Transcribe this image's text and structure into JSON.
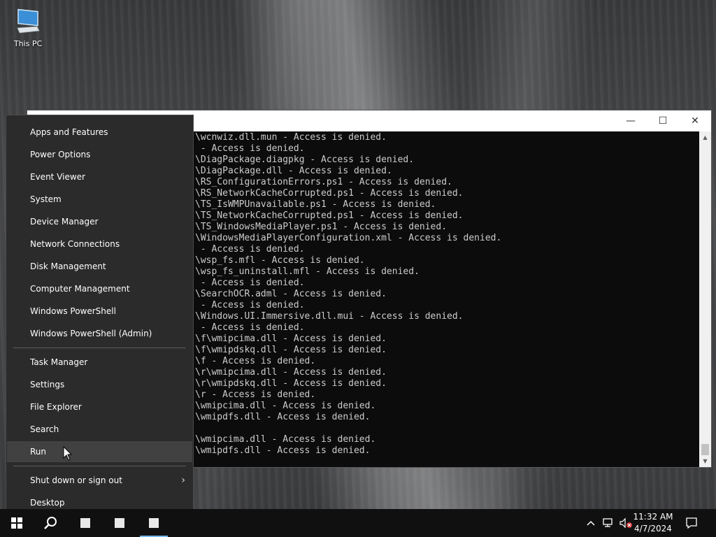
{
  "desktop": {
    "icons": [
      {
        "label": "This PC",
        "icon": "this-pc-icon"
      }
    ]
  },
  "console": {
    "window_controls": {
      "minimize": "—",
      "maximize": "☐",
      "close": "✕"
    },
    "lines": [
      "\\wcnwiz.dll.mun - Access is denied.",
      " - Access is denied.",
      "\\DiagPackage.diagpkg - Access is denied.",
      "\\DiagPackage.dll - Access is denied.",
      "\\RS_ConfigurationErrors.ps1 - Access is denied.",
      "\\RS_NetworkCacheCorrupted.ps1 - Access is denied.",
      "\\TS_IsWMPUnavailable.ps1 - Access is denied.",
      "\\TS_NetworkCacheCorrupted.ps1 - Access is denied.",
      "\\TS_WindowsMediaPlayer.ps1 - Access is denied.",
      "\\WindowsMediaPlayerConfiguration.xml - Access is denied.",
      " - Access is denied.",
      "\\wsp_fs.mfl - Access is denied.",
      "\\wsp_fs_uninstall.mfl - Access is denied.",
      " - Access is denied.",
      "\\SearchOCR.adml - Access is denied.",
      " - Access is denied.",
      "\\Windows.UI.Immersive.dll.mui - Access is denied.",
      " - Access is denied.",
      "\\f\\wmipcima.dll - Access is denied.",
      "\\f\\wmipdskq.dll - Access is denied.",
      "\\f - Access is denied.",
      "\\r\\wmipcima.dll - Access is denied.",
      "\\r\\wmipdskq.dll - Access is denied.",
      "\\r - Access is denied.",
      "\\wmipcima.dll - Access is denied.",
      "\\wmipdfs.dll - Access is denied.",
      "",
      "\\wmipcima.dll - Access is denied.",
      "\\wmipdfs.dll - Access is denied."
    ]
  },
  "winx_menu": {
    "group1": [
      "Apps and Features",
      "Power Options",
      "Event Viewer",
      "System",
      "Device Manager",
      "Network Connections",
      "Disk Management",
      "Computer Management",
      "Windows PowerShell",
      "Windows PowerShell (Admin)"
    ],
    "group2": [
      "Task Manager",
      "Settings",
      "File Explorer",
      "Search",
      "Run"
    ],
    "highlighted": "Run",
    "group3": [
      "Shut down or sign out",
      "Desktop"
    ]
  },
  "taskbar": {
    "icons": [
      "windows-start-icon",
      "search-icon",
      "app-icon",
      "app-icon",
      "app-icon"
    ],
    "tray": [
      "chevron-up-icon",
      "network-icon",
      "volume-muted-icon"
    ],
    "clock": {
      "time": "11:32 AM",
      "date": "4/7/2024"
    },
    "notification": "action-center-icon"
  }
}
